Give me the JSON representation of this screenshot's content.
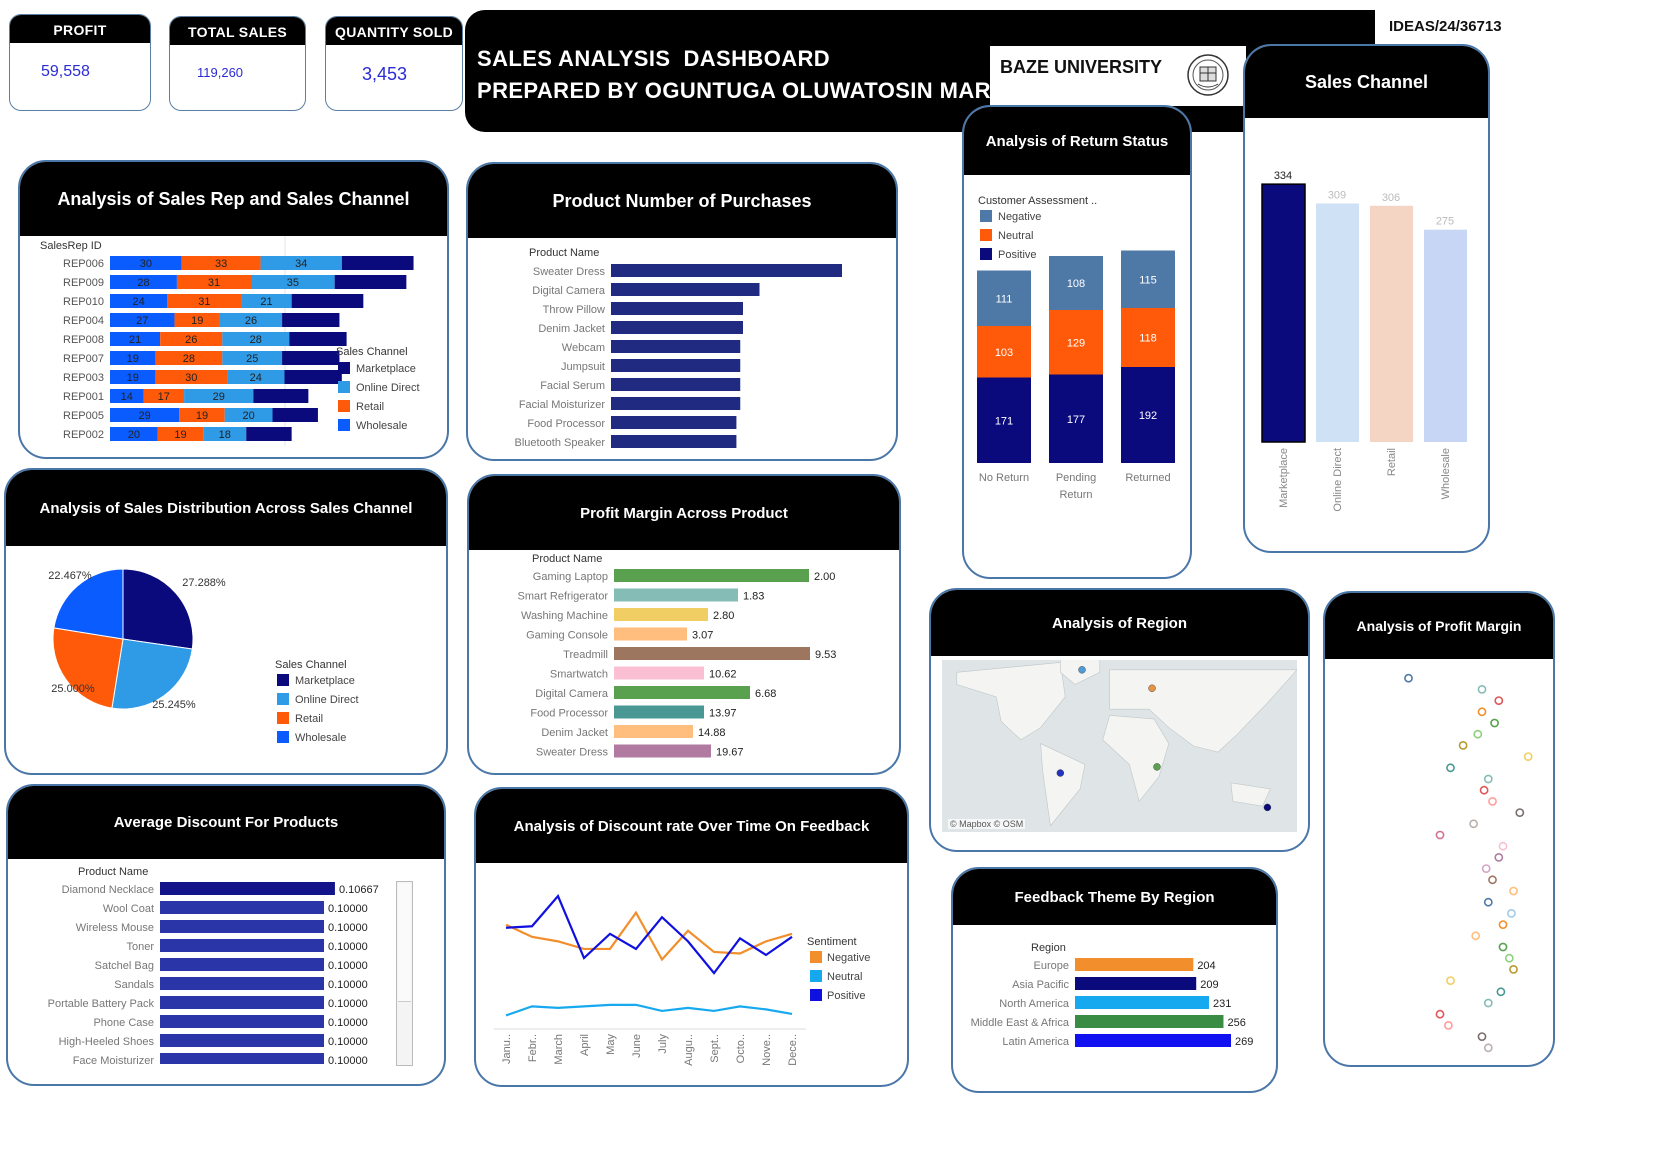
{
  "kpis": {
    "profit": {
      "label": "PROFIT",
      "value": "59,558"
    },
    "total_sales": {
      "label": "TOTAL SALES",
      "value": "119,260"
    },
    "quantity_sold": {
      "label": "QUANTITY SOLD",
      "value": "3,453"
    }
  },
  "header": {
    "title_line1": "SALES ANALYSIS  DASHBOARD",
    "title_line2": "PREPARED BY OGUNTUGA OLUWATOSIN MARY",
    "university": "BAZE UNIVERSITY",
    "student_id": "IDEAS/24/36713"
  },
  "panels": {
    "sales_rep": "Analysis of Sales Rep and Sales Channel",
    "purchases": "Product Number of Purchases",
    "return_status": "Analysis of Return Status",
    "sales_channel": "Sales Channel",
    "distribution": "Analysis of Sales Distribution Across Sales Channel",
    "profit_margin_product": "Profit Margin Across Product",
    "region": "Analysis of Region",
    "profit_margin": "Analysis of Profit Margin",
    "avg_discount": "Average Discount For Products",
    "discount_time": "Analysis of Discount rate Over Time On Feedback",
    "feedback_region": "Feedback Theme By Region"
  },
  "map": {
    "attribution": "© Mapbox © OSM"
  },
  "colors": {
    "marketplace": "#0a0a7d",
    "online_direct": "#2f9ae6",
    "retail": "#ff5a0a",
    "wholesale": "#0a5cff",
    "navy_bar": "#1f2a80",
    "kpi_value": "#2b2bd6"
  },
  "chart_data": [
    {
      "id": "sales_rep",
      "type": "bar",
      "stacked": true,
      "orientation": "horizontal",
      "row_header": "SalesRep ID",
      "categories": [
        "REP006",
        "REP009",
        "REP010",
        "REP004",
        "REP008",
        "REP007",
        "REP003",
        "REP001",
        "REP005",
        "REP002"
      ],
      "series": [
        {
          "name": "Wholesale",
          "color": "#0a5cff",
          "values": [
            30,
            28,
            24,
            27,
            21,
            19,
            19,
            14,
            29,
            20
          ]
        },
        {
          "name": "Retail",
          "color": "#ff5a0a",
          "values": [
            33,
            31,
            31,
            19,
            26,
            28,
            30,
            17,
            19,
            19
          ]
        },
        {
          "name": "Online Direct",
          "color": "#2f9ae6",
          "values": [
            34,
            35,
            21,
            26,
            28,
            25,
            24,
            29,
            20,
            18
          ]
        },
        {
          "name": "Marketplace",
          "color": "#0a0a7d",
          "values": [
            30,
            30,
            30,
            24,
            24,
            24,
            24,
            23,
            19,
            19
          ]
        }
      ],
      "legend_title": "Sales Channel",
      "legend": [
        "Marketplace",
        "Online Direct",
        "Retail",
        "Wholesale"
      ]
    },
    {
      "id": "purchases",
      "type": "bar",
      "orientation": "horizontal",
      "row_header": "Product Name",
      "categories": [
        "Sweater Dress",
        "Digital Camera",
        "Throw Pillow",
        "Denim Jacket",
        "Webcam",
        "Jumpsuit",
        "Facial Serum",
        "Facial Moisturizer",
        "Food Processor",
        "Bluetooth Speaker"
      ],
      "values": [
        42,
        27,
        24,
        24,
        23.5,
        23.5,
        23.5,
        23.5,
        22.8,
        22.8
      ]
    },
    {
      "id": "return_status",
      "type": "bar",
      "stacked": true,
      "categories": [
        "No Return",
        "Pending\nReturn",
        "Returned"
      ],
      "series": [
        {
          "name": "Positive",
          "color": "#0a0a7d",
          "values": [
            171,
            177,
            192
          ]
        },
        {
          "name": "Neutral",
          "color": "#ff5a0a",
          "values": [
            103,
            129,
            118
          ]
        },
        {
          "name": "Negative",
          "color": "#4e79a7",
          "values": [
            111,
            108,
            115
          ]
        }
      ],
      "legend_title": "Customer Assessment ..",
      "legend": [
        "Negative",
        "Neutral",
        "Positive"
      ]
    },
    {
      "id": "sales_channel",
      "type": "bar",
      "categories": [
        "Marketplace",
        "Online Direct",
        "Retail",
        "Wholesale"
      ],
      "values": [
        334,
        309,
        306,
        275
      ],
      "colors": [
        "#0a0a7d",
        "#cfe2f5",
        "#f4d5c4",
        "#c7d6f5"
      ]
    },
    {
      "id": "distribution",
      "type": "pie",
      "slices": [
        {
          "name": "Marketplace",
          "value": 27.288,
          "label": "27.288%",
          "color": "#0a0a7d"
        },
        {
          "name": "Online Direct",
          "value": 25.245,
          "label": "25.245%",
          "color": "#2f9ae6"
        },
        {
          "name": "Retail",
          "value": 25.0,
          "label": "25.000%",
          "color": "#ff5a0a"
        },
        {
          "name": "Wholesale",
          "value": 22.467,
          "label": "22.467%",
          "color": "#0a5cff"
        }
      ],
      "legend_title": "Sales Channel"
    },
    {
      "id": "profit_margin_product",
      "type": "bar",
      "orientation": "horizontal",
      "row_header": "Product Name",
      "categories": [
        "Gaming Laptop",
        "Smart Refrigerator",
        "Washing Machine",
        "Gaming Console",
        "Treadmill",
        "Smartwatch",
        "Digital Camera",
        "Food Processor",
        "Denim Jacket",
        "Sweater Dress"
      ],
      "values": [
        2.0,
        1.83,
        2.8,
        3.07,
        9.53,
        10.62,
        6.68,
        13.97,
        14.88,
        19.67
      ],
      "labels": [
        "2.00",
        "1.83",
        "2.80",
        "3.07",
        "9.53",
        "10.62",
        "6.68",
        "13.97",
        "14.88",
        "19.67"
      ],
      "colors": [
        "#59a14f",
        "#86bcb6",
        "#f1ce63",
        "#ffbe7d",
        "#9d7660",
        "#fabfd2",
        "#59a14f",
        "#499894",
        "#ffbe7d",
        "#b07aa1"
      ]
    },
    {
      "id": "region_map",
      "type": "scatter",
      "points": [
        {
          "lon": -38,
          "lat": 72,
          "color": "#4e9bd6"
        },
        {
          "lon": 33,
          "lat": 57,
          "color": "#e49444"
        },
        {
          "lon": -60,
          "lat": -12,
          "color": "#2432c4"
        },
        {
          "lon": 38,
          "lat": -7,
          "color": "#59a14f"
        },
        {
          "lon": 150,
          "lat": -40,
          "color": "#0a0a7d"
        }
      ]
    },
    {
      "id": "profit_margin_scatter",
      "type": "scatter",
      "markers": "open-circle",
      "points": [
        {
          "x": 0.35,
          "y": 0.98,
          "color": "#4e79a7"
        },
        {
          "x": 0.7,
          "y": 0.96,
          "color": "#86bcb6"
        },
        {
          "x": 0.78,
          "y": 0.94,
          "color": "#e15759"
        },
        {
          "x": 0.7,
          "y": 0.92,
          "color": "#f28e2b"
        },
        {
          "x": 0.76,
          "y": 0.9,
          "color": "#59a14f"
        },
        {
          "x": 0.68,
          "y": 0.88,
          "color": "#8cd17d"
        },
        {
          "x": 0.61,
          "y": 0.86,
          "color": "#b6992d"
        },
        {
          "x": 0.92,
          "y": 0.84,
          "color": "#f1ce63"
        },
        {
          "x": 0.55,
          "y": 0.82,
          "color": "#499894"
        },
        {
          "x": 0.73,
          "y": 0.8,
          "color": "#86bcb6"
        },
        {
          "x": 0.71,
          "y": 0.78,
          "color": "#e15759"
        },
        {
          "x": 0.75,
          "y": 0.76,
          "color": "#ff9d9a"
        },
        {
          "x": 0.88,
          "y": 0.74,
          "color": "#79706e"
        },
        {
          "x": 0.66,
          "y": 0.72,
          "color": "#bab0ac"
        },
        {
          "x": 0.5,
          "y": 0.7,
          "color": "#d37295"
        },
        {
          "x": 0.8,
          "y": 0.68,
          "color": "#fabfd2"
        },
        {
          "x": 0.78,
          "y": 0.66,
          "color": "#b07aa1"
        },
        {
          "x": 0.72,
          "y": 0.64,
          "color": "#d4a6c8"
        },
        {
          "x": 0.75,
          "y": 0.62,
          "color": "#9d7660"
        },
        {
          "x": 0.85,
          "y": 0.6,
          "color": "#ffbe7d"
        },
        {
          "x": 0.73,
          "y": 0.58,
          "color": "#4e79a7"
        },
        {
          "x": 0.84,
          "y": 0.56,
          "color": "#a0cbe8"
        },
        {
          "x": 0.8,
          "y": 0.54,
          "color": "#f28e2b"
        },
        {
          "x": 0.67,
          "y": 0.52,
          "color": "#ffbe7d"
        },
        {
          "x": 0.8,
          "y": 0.5,
          "color": "#59a14f"
        },
        {
          "x": 0.83,
          "y": 0.48,
          "color": "#8cd17d"
        },
        {
          "x": 0.85,
          "y": 0.46,
          "color": "#b6992d"
        },
        {
          "x": 0.55,
          "y": 0.44,
          "color": "#f1ce63"
        },
        {
          "x": 0.79,
          "y": 0.42,
          "color": "#499894"
        },
        {
          "x": 0.73,
          "y": 0.4,
          "color": "#86bcb6"
        },
        {
          "x": 0.5,
          "y": 0.38,
          "color": "#e15759"
        },
        {
          "x": 0.54,
          "y": 0.36,
          "color": "#ff9d9a"
        },
        {
          "x": 0.7,
          "y": 0.34,
          "color": "#79706e"
        },
        {
          "x": 0.73,
          "y": 0.32,
          "color": "#bab0ac"
        }
      ]
    },
    {
      "id": "avg_discount",
      "type": "bar",
      "orientation": "horizontal",
      "row_header": "Product Name",
      "categories": [
        "Diamond Necklace",
        "Wool Coat",
        "Wireless Mouse",
        "Toner",
        "Satchel Bag",
        "Sandals",
        "Portable Battery Pack",
        "Phone Case",
        "High-Heeled Shoes",
        "Face Moisturizer"
      ],
      "values": [
        0.10667,
        0.1,
        0.1,
        0.1,
        0.1,
        0.1,
        0.1,
        0.1,
        0.1,
        0.1
      ],
      "labels": [
        "0.10667",
        "0.10000",
        "0.10000",
        "0.10000",
        "0.10000",
        "0.10000",
        "0.10000",
        "0.10000",
        "0.10000",
        "0.10000"
      ]
    },
    {
      "id": "discount_time",
      "type": "line",
      "x": [
        "Janu..",
        "Febr..",
        "March",
        "April",
        "May",
        "June",
        "July",
        "Augu..",
        "Sept..",
        "Octo..",
        "Nove..",
        "Dece.."
      ],
      "series": [
        {
          "name": "Negative",
          "color": "#f28e2b",
          "values": [
            0.095,
            0.087,
            0.084,
            0.079,
            0.079,
            0.103,
            0.072,
            0.091,
            0.077,
            0.076,
            0.084,
            0.089
          ]
        },
        {
          "name": "Neutral",
          "color": "#17a9ef",
          "values": [
            0.035,
            0.041,
            0.04,
            0.041,
            0.042,
            0.042,
            0.038,
            0.04,
            0.038,
            0.041,
            0.039,
            0.036
          ]
        },
        {
          "name": "Positive",
          "color": "#1010e0",
          "values": [
            0.093,
            0.094,
            0.114,
            0.073,
            0.089,
            0.079,
            0.1,
            0.084,
            0.063,
            0.086,
            0.075,
            0.087
          ]
        }
      ],
      "legend_title": "Sentiment",
      "legend": [
        "Negative",
        "Neutral",
        "Positive"
      ]
    },
    {
      "id": "feedback_region",
      "type": "bar",
      "orientation": "horizontal",
      "row_header": "Region",
      "categories": [
        "Europe",
        "Asia Pacific",
        "North America",
        "Middle East & Africa",
        "Latin America"
      ],
      "values": [
        204,
        209,
        231,
        256,
        269
      ],
      "colors": [
        "#f28e2b",
        "#0a0a7d",
        "#17a9ef",
        "#3a8c44",
        "#1010f0"
      ]
    }
  ]
}
